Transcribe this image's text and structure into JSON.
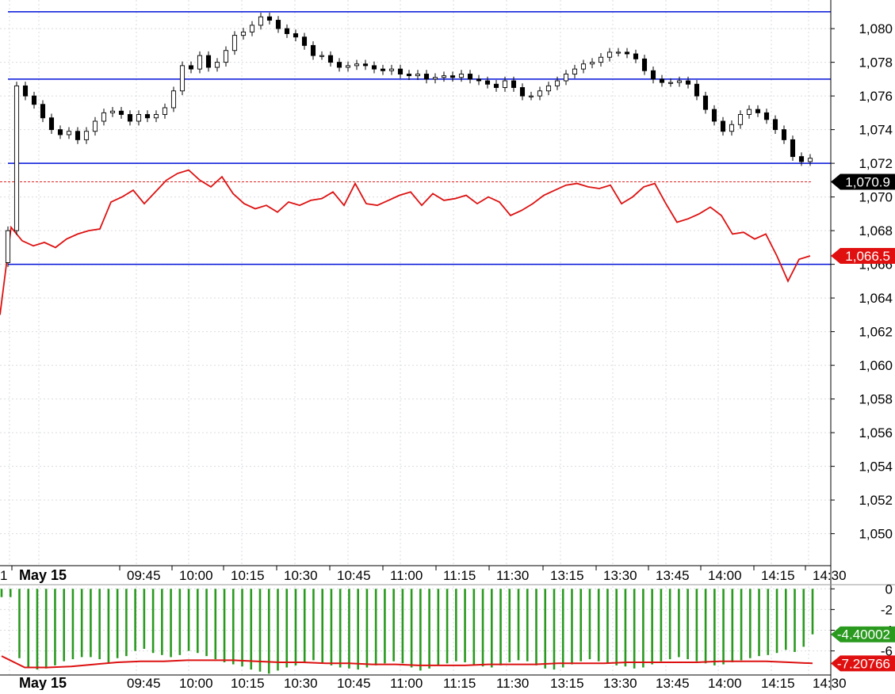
{
  "chart_data": [
    {
      "type": "candlestick",
      "x_ticks": [
        "May 15",
        "09:45",
        "10:00",
        "10:15",
        "10:30",
        "10:45",
        "11:00",
        "11:15",
        "11:30",
        "13:15",
        "13:30",
        "13:45",
        "14:00",
        "14:15",
        "14:30"
      ],
      "y_ticks": [
        "1,080",
        "1,078",
        "1,076",
        "1,074",
        "1,072",
        "1,070",
        "1,068",
        "1,066",
        "1,064",
        "1,062",
        "1,060",
        "1,058",
        "1,056",
        "1,054",
        "1,052",
        "1,050"
      ],
      "ylim": [
        1048.1,
        1081.7
      ],
      "grid": true,
      "horizontal_levels": [
        1081.0,
        1077.0,
        1072.0,
        1066.0
      ],
      "reference_level": 1070.9,
      "last_price_label": "1,070.9",
      "line_last_label": "1,066.5",
      "candle_close_series": [
        1068.0,
        1076.6,
        1076.0,
        1075.5,
        1074.7,
        1074.0,
        1073.7,
        1073.9,
        1073.4,
        1073.9,
        1074.5,
        1075.0,
        1075.1,
        1074.9,
        1074.5,
        1074.9,
        1074.7,
        1074.9,
        1075.3,
        1076.3,
        1077.8,
        1077.6,
        1078.4,
        1077.7,
        1078.0,
        1078.7,
        1079.6,
        1079.8,
        1080.2,
        1080.7,
        1080.5,
        1080.0,
        1079.7,
        1079.5,
        1079.0,
        1078.4,
        1078.4,
        1078.0,
        1077.7,
        1077.8,
        1077.9,
        1077.8,
        1077.6,
        1077.5,
        1077.6,
        1077.3,
        1077.2,
        1077.3,
        1077.0,
        1077.1,
        1077.2,
        1077.1,
        1077.3,
        1077.0,
        1076.9,
        1076.7,
        1076.5,
        1076.9,
        1076.5,
        1076.0,
        1076.0,
        1076.3,
        1076.6,
        1076.9,
        1077.3,
        1077.6,
        1077.9,
        1078.0,
        1078.3,
        1078.6,
        1078.6,
        1078.5,
        1078.2,
        1077.5,
        1077.0,
        1076.8,
        1076.8,
        1076.9,
        1076.7,
        1076.0,
        1075.2,
        1074.5,
        1073.9,
        1074.3,
        1074.9,
        1075.2,
        1075.0,
        1074.6,
        1074.0,
        1073.4,
        1072.4,
        1072.1,
        1072.3
      ],
      "line_series": [
        1063.0,
        1068.2,
        1067.4,
        1067.1,
        1067.3,
        1067.0,
        1067.5,
        1067.8,
        1068.0,
        1068.1,
        1069.7,
        1070.0,
        1070.4,
        1069.6,
        1070.3,
        1071.0,
        1071.4,
        1071.6,
        1071.0,
        1070.6,
        1071.2,
        1070.2,
        1069.6,
        1069.3,
        1069.5,
        1069.1,
        1069.7,
        1069.5,
        1069.8,
        1069.9,
        1070.3,
        1069.5,
        1070.8,
        1069.6,
        1069.5,
        1069.8,
        1070.1,
        1070.3,
        1069.5,
        1070.2,
        1069.8,
        1069.9,
        1070.1,
        1069.6,
        1070.0,
        1069.7,
        1068.9,
        1069.2,
        1069.6,
        1070.1,
        1070.4,
        1070.7,
        1070.8,
        1070.6,
        1070.5,
        1070.7,
        1069.6,
        1070.0,
        1070.6,
        1070.8,
        1069.6,
        1068.5,
        1068.7,
        1069.0,
        1069.4,
        1068.9,
        1067.8,
        1067.9,
        1067.5,
        1067.8,
        1066.5,
        1065.0,
        1066.3,
        1066.5
      ]
    },
    {
      "type": "bar",
      "y_ticks": [
        "0",
        "-2",
        "-4",
        "-6"
      ],
      "ylim": [
        -8.25,
        0.25
      ],
      "value_label_1": "-4.40002",
      "value_label_2": "-7.20766",
      "histogram_values": [
        -0.8,
        -0.8,
        -6.7,
        -7.6,
        -7.8,
        -7.7,
        -7.4,
        -7.0,
        -6.8,
        -6.6,
        -6.6,
        -6.8,
        -7.1,
        -6.7,
        -6.5,
        -6.0,
        -5.8,
        -6.2,
        -6.4,
        -6.6,
        -6.4,
        -6.0,
        -6.2,
        -6.5,
        -6.8,
        -7.1,
        -7.3,
        -7.5,
        -7.8,
        -8.0,
        -8.2,
        -7.9,
        -7.6,
        -7.4,
        -7.1,
        -6.9,
        -7.2,
        -7.4,
        -7.6,
        -7.7,
        -7.8,
        -7.6,
        -7.4,
        -7.2,
        -7.0,
        -7.2,
        -7.6,
        -7.9,
        -7.7,
        -7.4,
        -7.2,
        -7.0,
        -7.1,
        -7.3,
        -7.5,
        -7.6,
        -7.4,
        -7.1,
        -6.9,
        -7.0,
        -7.4,
        -7.7,
        -7.8,
        -7.6,
        -7.3,
        -7.0,
        -6.8,
        -7.0,
        -7.2,
        -7.4,
        -7.5,
        -7.7,
        -7.6,
        -7.3,
        -7.0,
        -6.8,
        -6.6,
        -6.8,
        -7.0,
        -7.2,
        -7.4,
        -7.3,
        -7.1,
        -6.9,
        -6.7,
        -6.5,
        -6.4,
        -6.2,
        -5.9,
        -6.1,
        -5.6,
        -4.4
      ],
      "signal_values": [
        -6.5,
        -7.6,
        -7.6,
        -7.5,
        -7.3,
        -7.1,
        -7.0,
        -7.0,
        -6.9,
        -6.9,
        -6.9,
        -7.0,
        -7.1,
        -7.1,
        -7.2,
        -7.2,
        -7.3,
        -7.3,
        -7.4,
        -7.4,
        -7.4,
        -7.3,
        -7.3,
        -7.3,
        -7.2,
        -7.2,
        -7.2,
        -7.1,
        -7.1,
        -7.1,
        -7.1,
        -7.0,
        -7.0,
        -7.0,
        -7.1,
        -7.2
      ]
    }
  ]
}
